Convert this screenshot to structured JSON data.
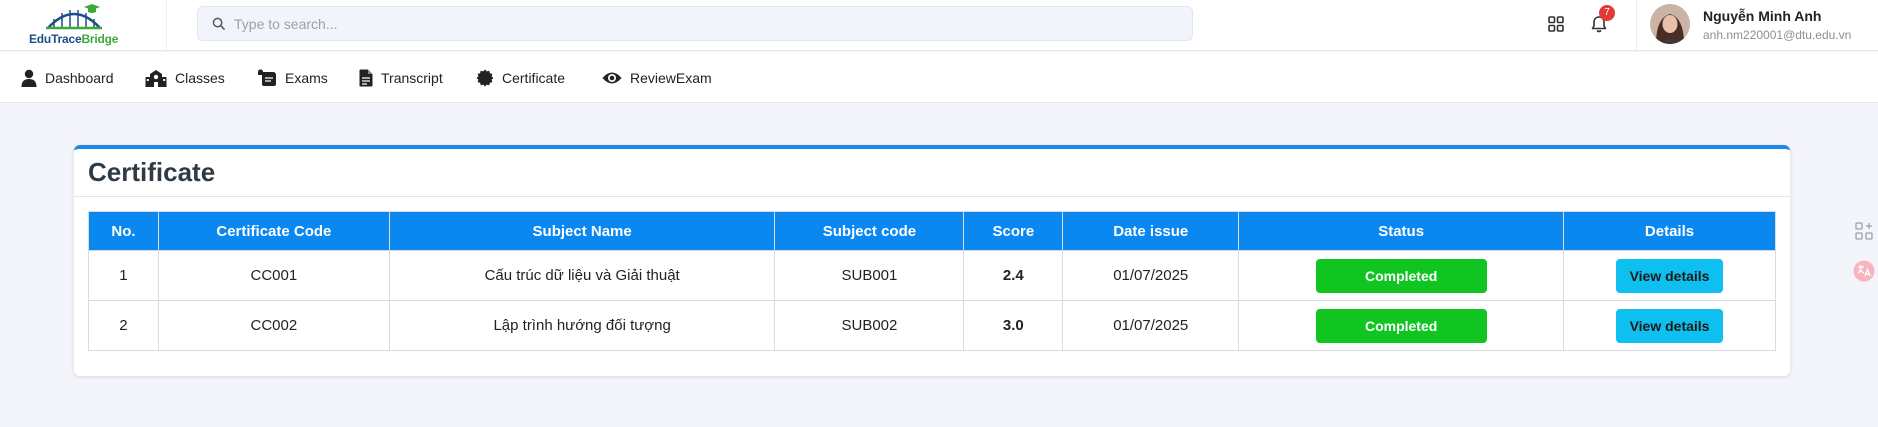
{
  "brand": {
    "name_part1": "EduTrace",
    "name_part2": "Bridge",
    "primary": "#1b4f8a",
    "secondary": "#3aa935"
  },
  "search": {
    "placeholder": "Type to search..."
  },
  "header": {
    "notification_count": "7",
    "apps_icon": "grid-icon",
    "bell_icon": "bell-icon"
  },
  "user": {
    "name": "Nguyễn Minh Anh",
    "email": "anh.nm220001@dtu.edu.vn"
  },
  "nav": {
    "items": [
      {
        "label": "Dashboard",
        "icon": "user-icon"
      },
      {
        "label": "Classes",
        "icon": "school-icon"
      },
      {
        "label": "Exams",
        "icon": "scroll-icon"
      },
      {
        "label": "Transcript",
        "icon": "document-icon"
      },
      {
        "label": "Certificate",
        "icon": "certificate-icon"
      },
      {
        "label": "ReviewExam",
        "icon": "eye-icon"
      }
    ]
  },
  "page": {
    "title": "Certificate"
  },
  "table": {
    "headers": [
      "No.",
      "Certificate Code",
      "Subject Name",
      "Subject code",
      "Score",
      "Date issue",
      "Status",
      "Details"
    ],
    "rows": [
      {
        "no": "1",
        "code": "CC001",
        "subject": "Cấu trúc dữ liệu và Giải thuật",
        "subject_code": "SUB001",
        "score": "2.4",
        "date": "01/07/2025",
        "status": "Completed",
        "action": "View details"
      },
      {
        "no": "2",
        "code": "CC002",
        "subject": "Lập trình hướng đối tượng",
        "subject_code": "SUB002",
        "score": "3.0",
        "date": "01/07/2025",
        "status": "Completed",
        "action": "View details"
      }
    ]
  },
  "colors": {
    "header_blue": "#0a88f0",
    "accent_border": "#1e88e5",
    "status_green": "#11c521",
    "score_green": "#2bbf2b",
    "details_cyan": "#0dc0ef",
    "badge_red": "#e53935"
  }
}
